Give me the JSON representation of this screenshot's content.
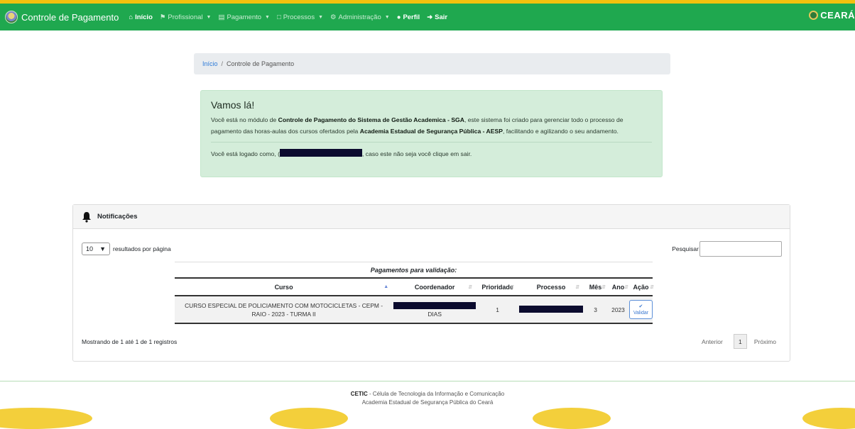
{
  "app": {
    "title": "Controle de Pagamento",
    "brand_right": "CEARÁ"
  },
  "nav": {
    "inicio": "Início",
    "profissional": "Profissional",
    "pagamento": "Pagamento",
    "processos": "Processos",
    "administracao": "Administração",
    "perfil": "Perfil",
    "sair": "Sair"
  },
  "breadcrumb": {
    "home": "Início",
    "separator": "/",
    "current": "Controle de Pagamento"
  },
  "alert": {
    "heading": "Vamos lá!",
    "p1_a": "Você está no módulo de ",
    "p1_b": "Controle de Pagamento do Sistema de Gestão Academica - SGA",
    "p1_c": ", este sistema foi criado para gerenciar todo o processo de pagamento das horas-aulas dos cursos ofertados pela ",
    "p1_d": "Academia Estadual de Segurança Pública - AESP",
    "p1_e": ", facilitando e agilizando o seu andamento.",
    "p2_a": "Você está logado como, ",
    "p2_b": "(",
    "p2_c": ", caso este não seja você clique em sair."
  },
  "notifications": {
    "title": "Notificações",
    "length_value": "10",
    "length_label": "resultados por página",
    "search_label": "Pesquisar",
    "caption": "Pagamentos para validação:",
    "columns": [
      "Curso",
      "Coordenador",
      "Prioridade",
      "Processo",
      "Mês",
      "Ano",
      "Ação"
    ],
    "row": {
      "curso": "CURSO ESPECIAL DE POLICIAMENTO COM MOTOCICLETAS - CEPM - RAIO - 2023 - TURMA II",
      "coordenador_suffix": "DIAS",
      "prioridade": "1",
      "mes": "3",
      "ano": "2023",
      "acao": "Validar"
    },
    "info": "Mostrando de 1 até 1 de 1 registros",
    "prev": "Anterior",
    "page": "1",
    "next": "Próximo"
  },
  "footer": {
    "line1_bold": "CETIC",
    "line1_rest": " - Célula de Tecnologia da Informação e Comunicação",
    "line2": "Academia Estadual de Segurança Pública do Ceará"
  },
  "colors": {
    "navbar": "#1fa84f",
    "accent": "#f2c10e",
    "alert_bg": "#d4edda",
    "link": "#2a7ad8"
  }
}
